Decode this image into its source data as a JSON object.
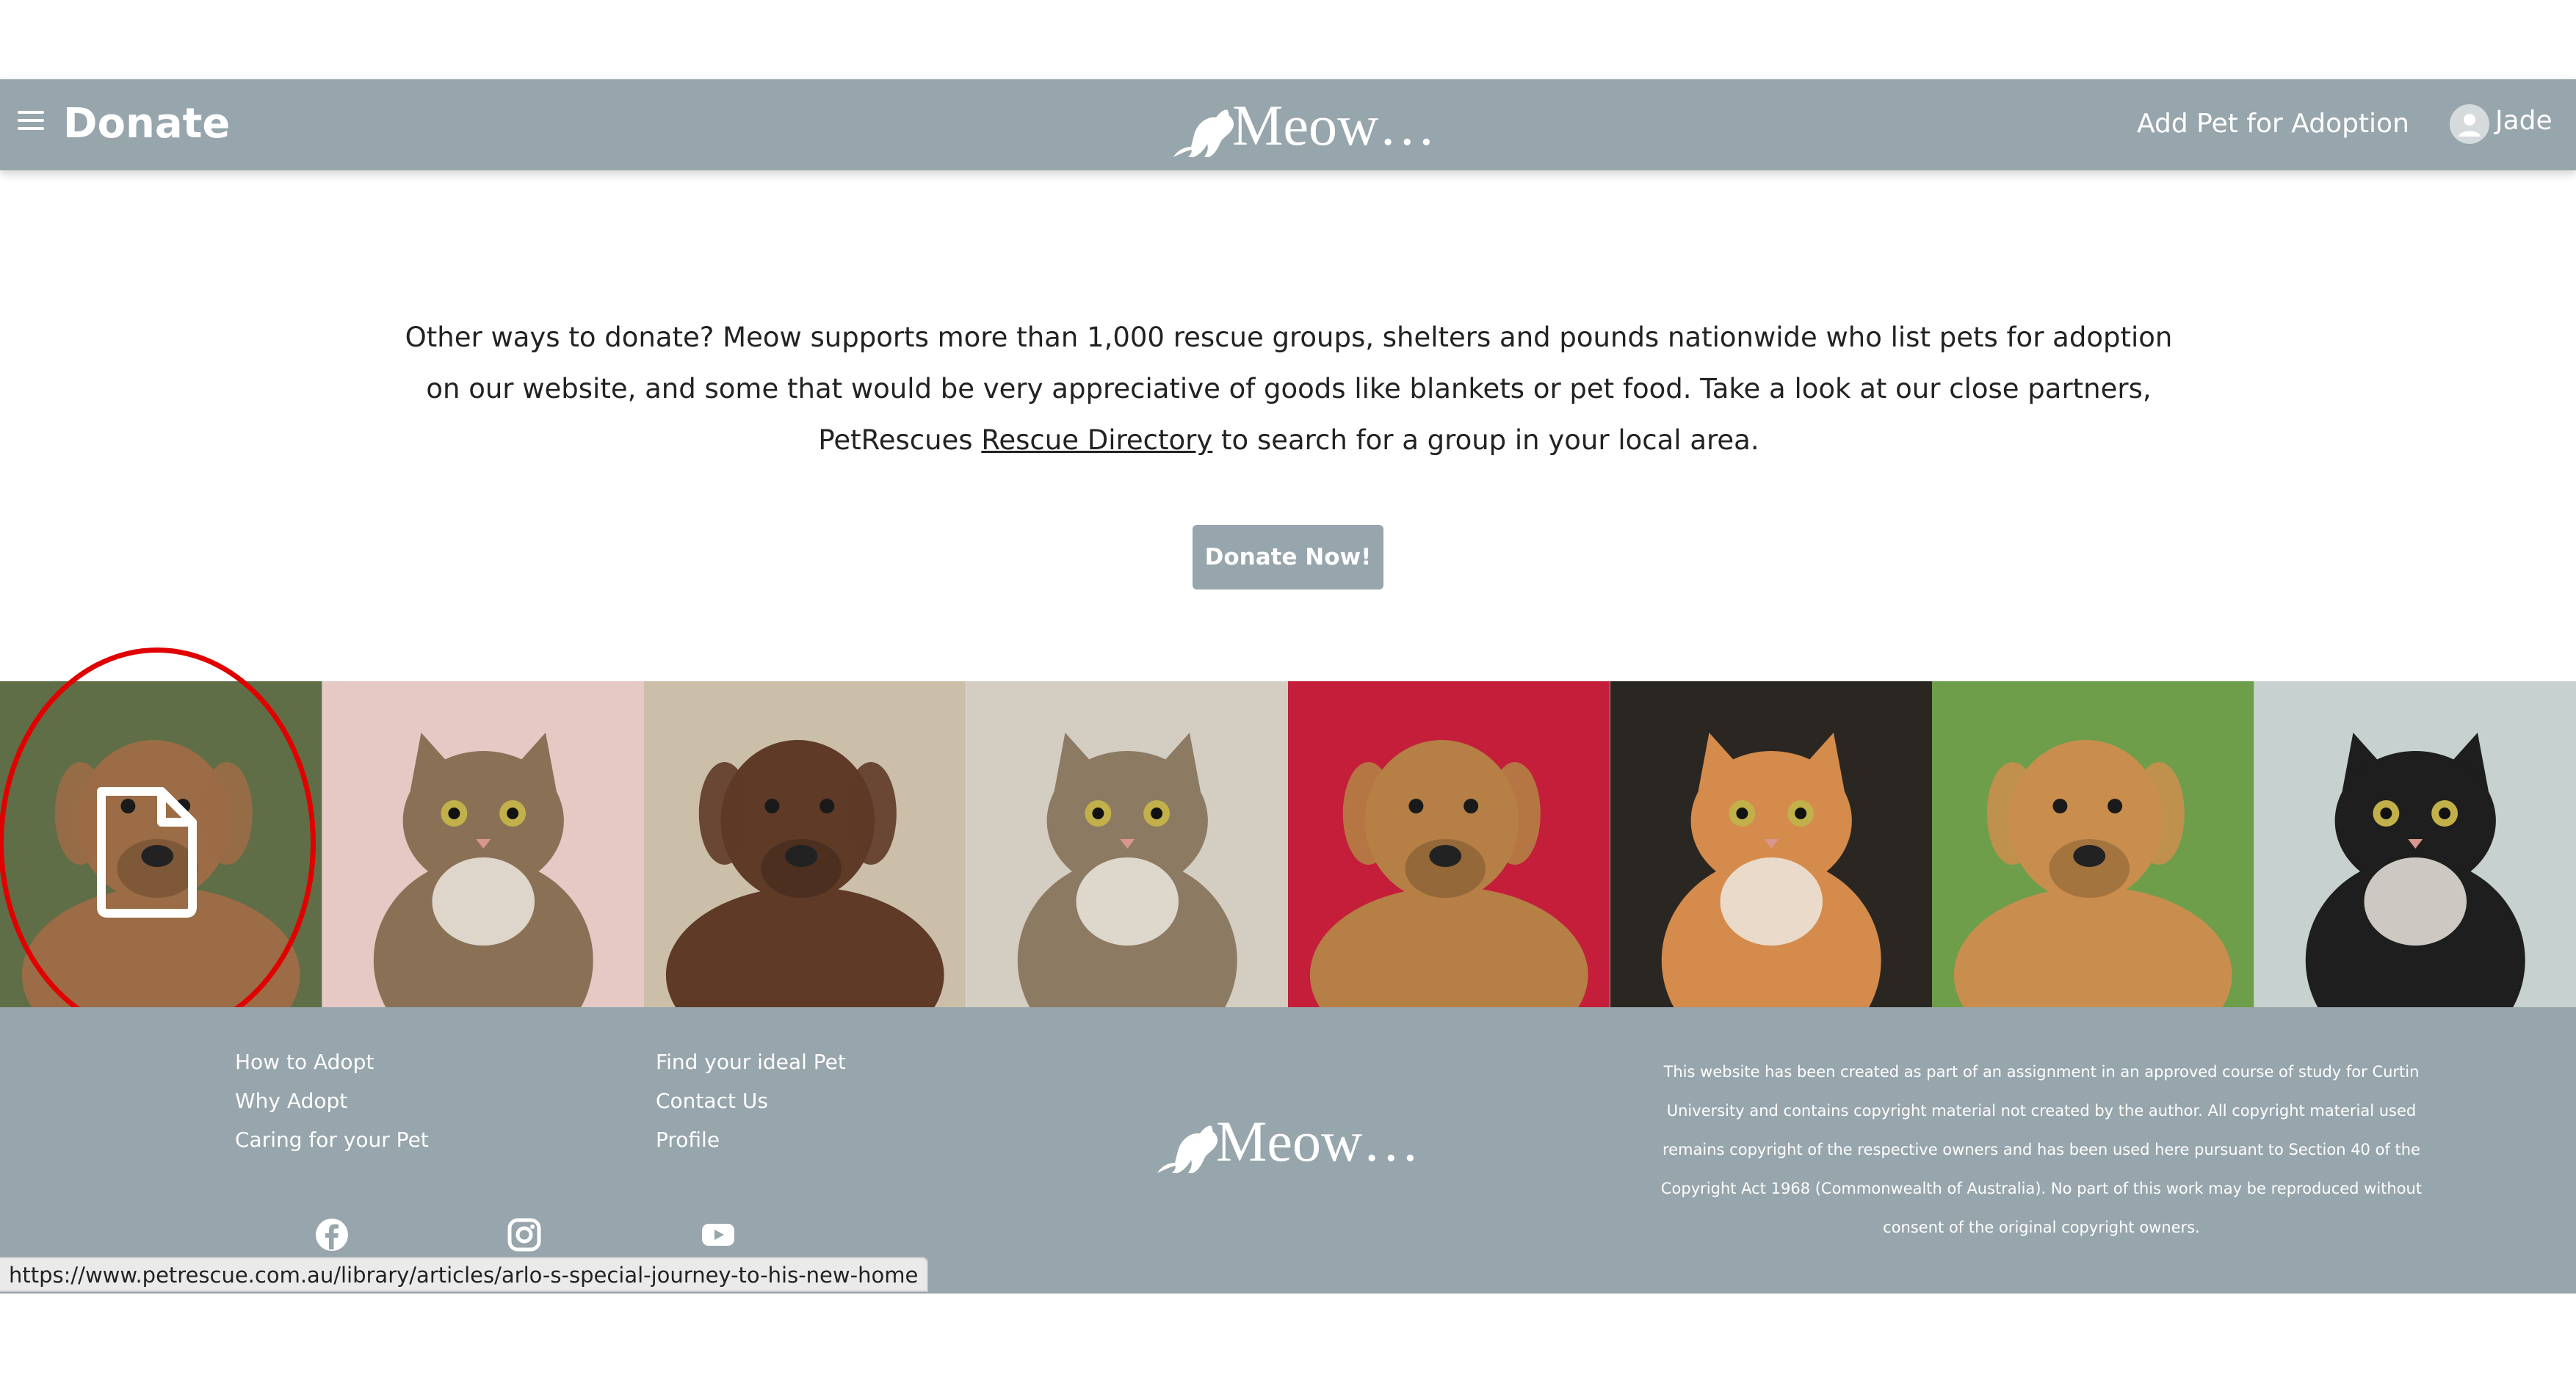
{
  "navbar": {
    "title": "Donate",
    "logo_text": "Meow…",
    "add_pet_link": "Add Pet for Adoption",
    "user_name": "Jade"
  },
  "intro": {
    "text_before": "Other ways to donate? Meow supports more than 1,000 rescue groups, shelters and pounds nationwide who list pets for adoption on our website, and some that would be very appreciative of goods like blankets or pet food. Take a look at our close partners, PetRescues ",
    "link_text": "Rescue Directory",
    "text_after": " to search for a group in your local area."
  },
  "donate_button": "Donate Now!",
  "gallery": {
    "tiles": [
      {
        "animal": "dog",
        "bg": "#5f6e46",
        "fur": "#9b6c45"
      },
      {
        "animal": "cat",
        "bg": "#e6c9c5",
        "fur": "#8a7156"
      },
      {
        "animal": "dog",
        "bg": "#cbbfa9",
        "fur": "#5e3a27"
      },
      {
        "animal": "cat",
        "bg": "#d3cdc2",
        "fur": "#8d7a62"
      },
      {
        "animal": "dog",
        "bg": "#c41e3a",
        "fur": "#b57f45"
      },
      {
        "animal": "cat",
        "bg": "#2a2622",
        "fur": "#d48b4b"
      },
      {
        "animal": "dog",
        "bg": "#6e9e4a",
        "fur": "#c98e4e"
      },
      {
        "animal": "cat",
        "bg": "#c7d1cf",
        "fur": "#1e1e1e"
      }
    ]
  },
  "footer": {
    "col1": [
      "How to Adopt",
      "Why Adopt",
      "Caring for your Pet"
    ],
    "col2": [
      "Find your ideal Pet",
      "Contact Us",
      "Profile"
    ],
    "logo_text": "Meow…",
    "copyright": "This website has been created as part of an assignment in an approved course of study for Curtin University and contains copyright material not created by the author. All copyright material used remains copyright of the respective owners and has been used here pursuant to Section 40 of the Copyright Act 1968 (Commonwealth of Australia). No part of this work may be reproduced without consent of the original copyright owners.",
    "social_icons": [
      "facebook-icon",
      "instagram-icon",
      "youtube-icon"
    ]
  },
  "status_bar": {
    "url": "https://www.petrescue.com.au/library/articles/arlo-s-special-journey-to-his-new-home"
  },
  "colors": {
    "brand": "#97a5ac",
    "annotation": "#e10000"
  }
}
